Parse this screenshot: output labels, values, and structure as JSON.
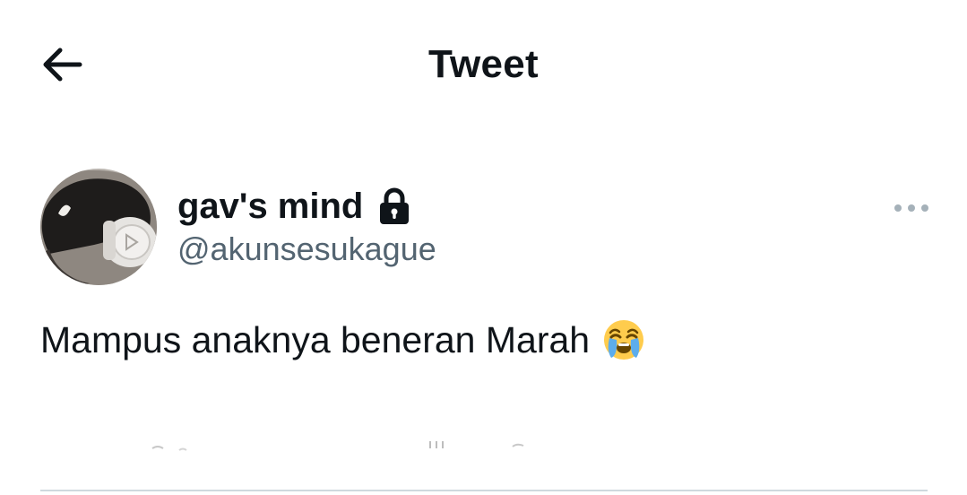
{
  "header": {
    "title": "Tweet",
    "back_icon": "arrow-left-icon"
  },
  "author": {
    "display_name": "gav's mind",
    "handle": "@akunsesukague",
    "protected_icon": "lock-icon",
    "avatar_icon": "profile-photo"
  },
  "tweet": {
    "text": "Mampus anaknya beneran Marah",
    "emoji": "loudly-crying-face-icon"
  },
  "more_icon": "more-horizontal-icon",
  "colors": {
    "text_primary": "#0f1419",
    "text_secondary": "#536471",
    "divider": "#cfd9de",
    "more_dots": "#a5b1b9"
  }
}
